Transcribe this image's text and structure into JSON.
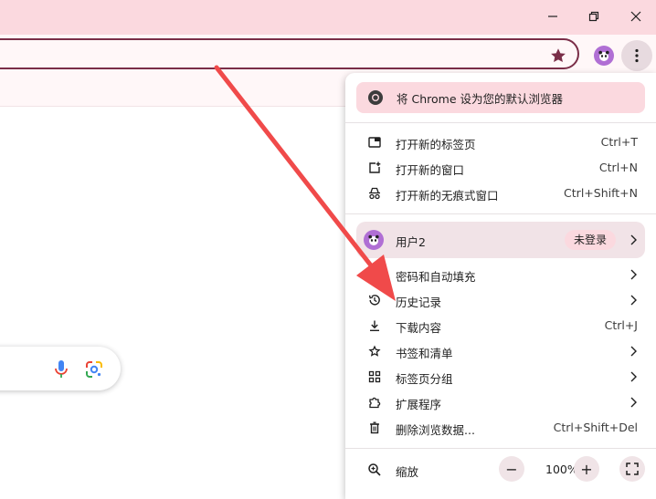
{
  "window": {
    "minimize_icon": "minimize-icon",
    "restore_icon": "restore-icon",
    "close_icon": "close-icon"
  },
  "toolbar": {
    "bookmark_icon": "star-icon",
    "profile_icon": "panda-avatar-icon",
    "menu_icon": "three-dots-vertical-icon"
  },
  "menu": {
    "default_banner": "将 Chrome 设为您的默认浏览器",
    "group1": [
      {
        "label": "打开新的标签页",
        "shortcut": "Ctrl+T",
        "icon": "new-tab-icon"
      },
      {
        "label": "打开新的窗口",
        "shortcut": "Ctrl+N",
        "icon": "new-window-icon"
      },
      {
        "label": "打开新的无痕式窗口",
        "shortcut": "Ctrl+Shift+N",
        "icon": "incognito-icon"
      }
    ],
    "profile": {
      "name": "用户2",
      "status": "未登录"
    },
    "group2": [
      {
        "label": "密码和自动填充",
        "icon": "key-icon"
      },
      {
        "label": "历史记录",
        "icon": "history-icon"
      },
      {
        "label": "下载内容",
        "shortcut": "Ctrl+J",
        "icon": "download-icon"
      },
      {
        "label": "书签和清单",
        "icon": "star-outline-icon"
      },
      {
        "label": "标签页分组",
        "icon": "grid-icon"
      },
      {
        "label": "扩展程序",
        "icon": "puzzle-icon"
      },
      {
        "label": "删除浏览数据...",
        "shortcut": "Ctrl+Shift+Del",
        "icon": "trash-icon"
      }
    ],
    "zoom": {
      "label": "缩放",
      "minus": "−",
      "value": "100%",
      "plus": "+"
    }
  },
  "colors": {
    "titlebar": "#fbd9df",
    "accent": "#7a2e48",
    "arrow": "#f04a4a"
  }
}
